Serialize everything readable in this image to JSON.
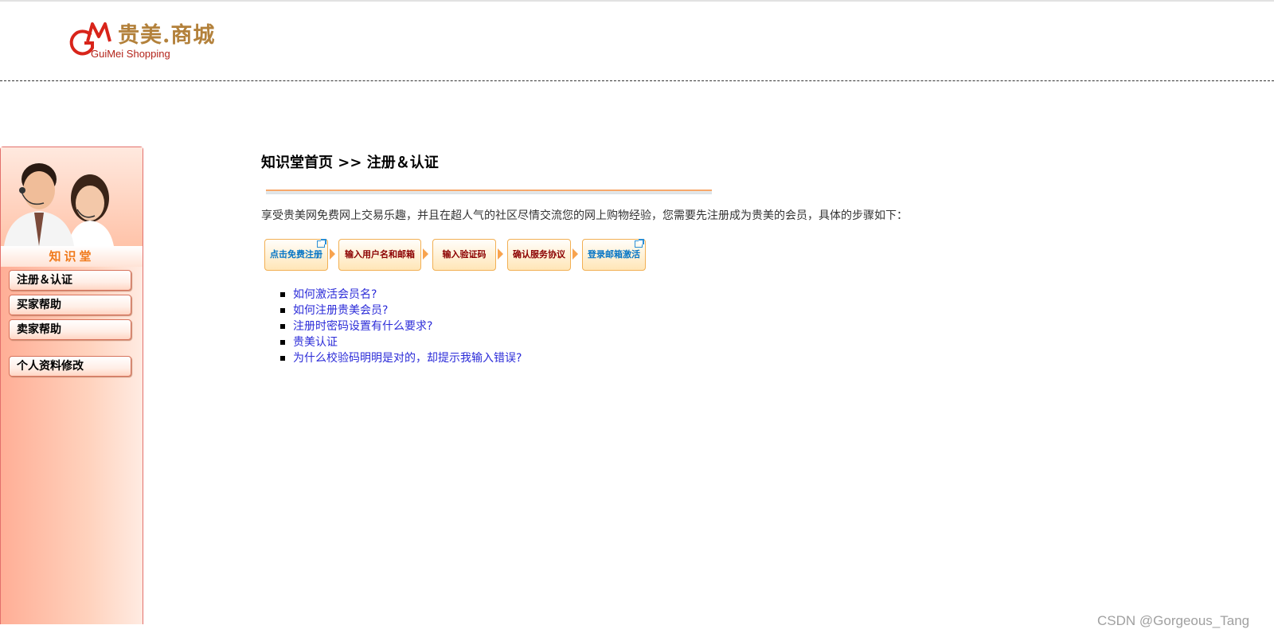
{
  "logo": {
    "mark": "GM",
    "name_cn": "贵美.商城",
    "name_en": "GuiMei Shopping"
  },
  "sidebar": {
    "title": "知识堂",
    "nav": [
      {
        "label": "注册＆认证"
      },
      {
        "label": "买家帮助"
      },
      {
        "label": "卖家帮助"
      },
      {
        "label": "个人资料修改"
      }
    ]
  },
  "breadcrumb": {
    "home": "知识堂首页",
    "separator": ">>",
    "current": "注册＆认证"
  },
  "intro": "享受贵美网免费网上交易乐趣，并且在超人气的社区尽情交流您的网上购物经验，您需要先注册成为贵美的会员，具体的步骤如下：",
  "steps": [
    {
      "label": "点击免费注册",
      "color": "#0776c6",
      "icon": "external-link-icon"
    },
    {
      "label": "输入用户名和邮箱",
      "color": "#8b0000"
    },
    {
      "label": "输入验证码",
      "color": "#8b0000"
    },
    {
      "label": "确认服务协议",
      "color": "#8b0000"
    },
    {
      "label": "登录邮箱激活",
      "color": "#0776c6",
      "icon": "external-link-icon"
    }
  ],
  "faq": [
    {
      "text": "如何激活会员名?"
    },
    {
      "text": "如何注册贵美会员?"
    },
    {
      "text": "注册时密码设置有什么要求?"
    },
    {
      "text": "贵美认证"
    },
    {
      "text": "为什么校验码明明是对的，却提示我输入错误?"
    }
  ],
  "watermark": "CSDN @Gorgeous_Tang",
  "colors": {
    "accent_orange": "#f07a1c",
    "link_blue": "#2b2bd8",
    "sidebar_border": "#e3706c"
  }
}
